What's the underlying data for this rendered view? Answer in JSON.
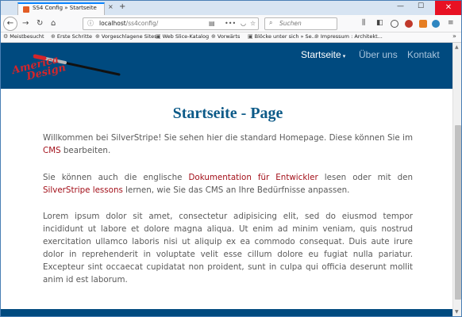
{
  "browser": {
    "tab_title": "SS4 Config » Startseite",
    "tab_close": "×",
    "new_tab": "+",
    "window_min": "—",
    "window_max": "☐",
    "window_close": "✕",
    "url_host": "localhost",
    "url_path": "/ss4config/",
    "search_placeholder": "Suchen",
    "icons": {
      "back": "←",
      "forward": "→",
      "reload": "↻",
      "home": "⌂",
      "info": "ⓘ",
      "reader": "▤",
      "more": "•••",
      "pocket": "◡",
      "bookmark_star": "☆",
      "search": "⌕",
      "library": "⫼",
      "sidebar": "◧",
      "menu": "≡"
    },
    "bookmarks": [
      {
        "icon": "⚙",
        "label": "Meistbesucht"
      },
      {
        "icon": "⊕",
        "label": "Erste Schritte"
      },
      {
        "icon": "⊕",
        "label": "Vorgeschlagene Sites"
      },
      {
        "icon": "▣",
        "label": "Web Slice-Katalog"
      },
      {
        "icon": "⊕",
        "label": "Vorwärts"
      },
      {
        "icon": "▣",
        "label": "Blöcke unter sich » Se..."
      },
      {
        "icon": "⊕",
        "label": "Impressum : Architekt..."
      }
    ],
    "bookmarks_more": "»"
  },
  "site": {
    "logo_line1": "America",
    "logo_line2": "Design",
    "nav": [
      {
        "label": "Startseite",
        "active": true
      },
      {
        "label": "Über uns",
        "active": false
      },
      {
        "label": "Kontakt",
        "active": false
      }
    ],
    "nav_caret": "▾"
  },
  "content": {
    "title": "Startseite - Page",
    "p1_a": "Willkommen bei SilverStripe! Sie sehen hier die standard Homepage. Diese können Sie im ",
    "p1_link": "CMS",
    "p1_b": " bearbeiten.",
    "p2_a": "Sie können auch die englische ",
    "p2_link1": "Dokumentation für Entwickler",
    "p2_b": " lesen oder mit den ",
    "p2_link2": "SilverStripe lessons",
    "p2_c": " lernen, wie Sie das CMS an Ihre Bedürfnisse anpassen.",
    "p3": "Lorem ipsum dolor sit amet, consectetur adipisicing elit, sed do eiusmod tempor incididunt ut labore et dolore magna aliqua. Ut enim ad minim veniam, quis nostrud exercitation ullamco laboris nisi ut aliquip ex ea commodo consequat. Duis aute irure dolor in reprehenderit in voluptate velit esse cillum dolore eu fugiat nulla pariatur. Excepteur sint occaecat cupidatat non proident, sunt in culpa qui officia deserunt mollit anim id est laborum."
  },
  "colors": {
    "header_bg": "#004a7f",
    "title": "#0c5a88",
    "link": "#a3101a",
    "body_text": "#5a5a5a"
  }
}
